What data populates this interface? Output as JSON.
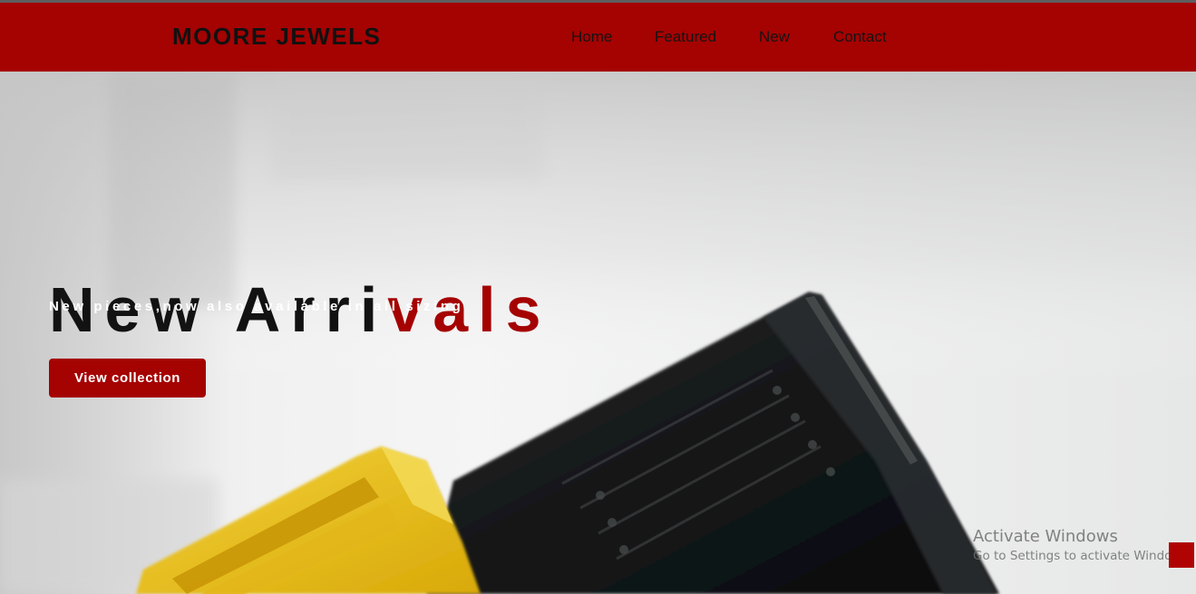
{
  "brand": {
    "name": "MOORE JEWELS"
  },
  "nav": {
    "items": [
      {
        "label": "Home"
      },
      {
        "label": "Featured"
      },
      {
        "label": "New"
      },
      {
        "label": "Contact"
      }
    ]
  },
  "hero": {
    "title_dark": "New Arri",
    "title_accent": "vals",
    "subtitle": "New pieces,now also available in all sizing",
    "cta_label": "View collection"
  },
  "os_watermark": {
    "title": "Activate Windows",
    "subtitle": "Go to Settings to activate Windows."
  },
  "colors": {
    "brand_red": "#a50202",
    "text_dark": "#121212",
    "white": "#ffffff"
  },
  "icons": {
    "scroll_top": "scroll-top-icon"
  }
}
